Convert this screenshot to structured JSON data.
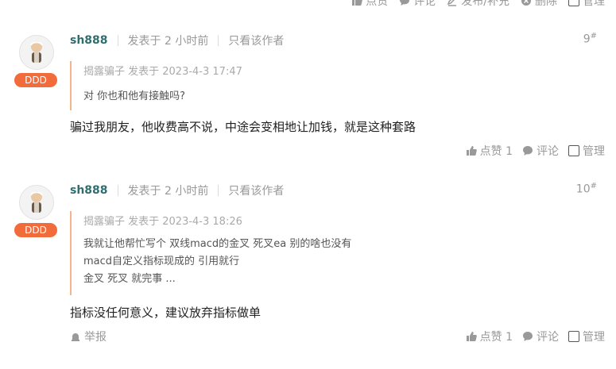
{
  "top_actions": {
    "like": "点赞",
    "comment": "评论",
    "publish": "发布/补充",
    "delete": "删除",
    "manage": "管理"
  },
  "posts": [
    {
      "username": "sh888",
      "badge": "DDD",
      "posted": "发表于 2 小时前",
      "only_author": "只看该作者",
      "floor_num": "9",
      "floor_mark": "#",
      "quote": {
        "head": "揭露骗子 发表于 2023-4-3 17:47",
        "lines": [
          "对 你也和他有接触吗?"
        ]
      },
      "content": "骗过我朋友，他收费高不说，中途会变相地让加钱，就是这种套路",
      "actions": {
        "like": "点赞 1",
        "comment": "评论",
        "manage": "管理"
      }
    },
    {
      "username": "sh888",
      "badge": "DDD",
      "posted": "发表于 2 小时前",
      "only_author": "只看该作者",
      "floor_num": "10",
      "floor_mark": "#",
      "quote": {
        "head": "揭露骗子 发表于 2023-4-3 18:26",
        "lines": [
          "我就让他帮忙写个 双线macd的金叉 死叉ea 别的啥也没有",
          "macd自定义指标现成的 引用就行",
          "金叉 死叉 就完事 ..."
        ]
      },
      "content": "指标没任何意义，建议放弃指标做单",
      "report": "举报",
      "actions": {
        "like": "点赞 1",
        "comment": "评论",
        "manage": "管理"
      }
    }
  ],
  "colors": {
    "accent": "#f26b3a",
    "username": "#2f6f6f",
    "quote_border": "#f4b58e",
    "muted": "#999999"
  }
}
